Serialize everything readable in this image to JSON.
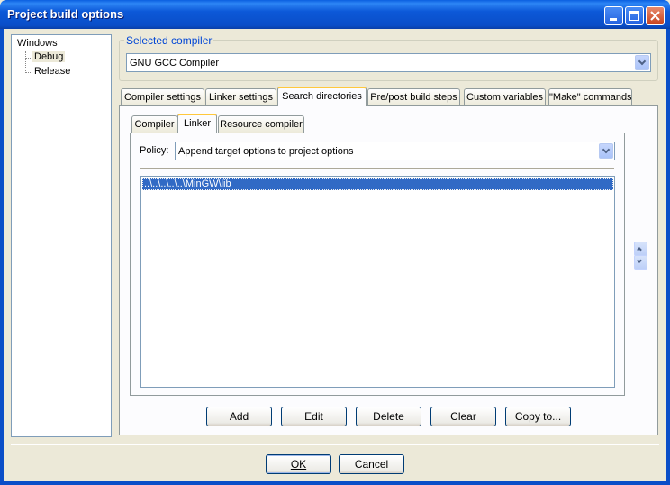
{
  "window": {
    "title": "Project build options",
    "controls": [
      "minimize-icon",
      "maximize-icon",
      "close-icon"
    ]
  },
  "tree": {
    "root": "Windows",
    "children": [
      "Debug",
      "Release"
    ],
    "selected": "Debug"
  },
  "compiler_group": {
    "label": "Selected compiler",
    "value": "GNU GCC Compiler"
  },
  "main_tabs": [
    "Compiler settings",
    "Linker settings",
    "Search directories",
    "Pre/post build steps",
    "Custom variables",
    "\"Make\" commands"
  ],
  "main_tab_active": "Search directories",
  "sub_tabs": [
    "Compiler",
    "Linker",
    "Resource compiler"
  ],
  "sub_tab_active": "Linker",
  "policy": {
    "label": "Policy:",
    "value": "Append target options to project options"
  },
  "directories": [
    "..\\..\\..\\..\\..\\MinGW\\lib"
  ],
  "buttons": {
    "add": "Add",
    "edit": "Edit",
    "delete": "Delete",
    "clear": "Clear",
    "copy_to": "Copy to..."
  },
  "dialog_buttons": {
    "ok": "OK",
    "cancel": "Cancel"
  },
  "colors": {
    "titlebar": "#0a4ec8",
    "selection": "#316ac5",
    "active_tab_accent": "#ffc83c",
    "group_label": "#0046d5"
  }
}
